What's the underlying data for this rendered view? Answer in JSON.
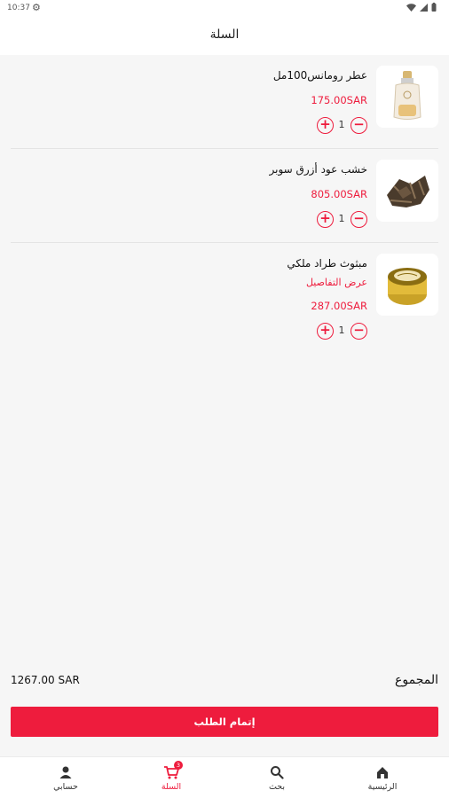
{
  "status_bar": {
    "time": "10:37"
  },
  "header": {
    "title": "السلة"
  },
  "cart": {
    "items": [
      {
        "name": "عطر رومانس100مل",
        "price": "175.00SAR",
        "quantity": "1",
        "image": "perfume-bottle-image"
      },
      {
        "name": "خشب عود أزرق سوبر",
        "price": "805.00SAR",
        "quantity": "1",
        "image": "oud-wood-chips-image"
      },
      {
        "name": "مبثوث طراد ملكي",
        "details_link": "عرض التفاصيل",
        "price": "287.00SAR",
        "quantity": "1",
        "image": "gold-jar-image"
      }
    ],
    "plus_symbol": "+",
    "minus_symbol": "−"
  },
  "summary": {
    "total_label": "المجموع",
    "total_value": "1267.00 SAR",
    "checkout_label": "إتمام الطلب"
  },
  "nav": {
    "items": [
      {
        "label": "الرئيسية",
        "icon": "home-icon"
      },
      {
        "label": "بحث",
        "icon": "search-icon"
      },
      {
        "label": "السلة",
        "icon": "cart-icon",
        "active": true,
        "badge": "3"
      },
      {
        "label": "حسابي",
        "icon": "person-icon"
      }
    ]
  },
  "colors": {
    "accent": "#ee1c3d",
    "background": "#f6f6f6",
    "surface": "#ffffff"
  }
}
